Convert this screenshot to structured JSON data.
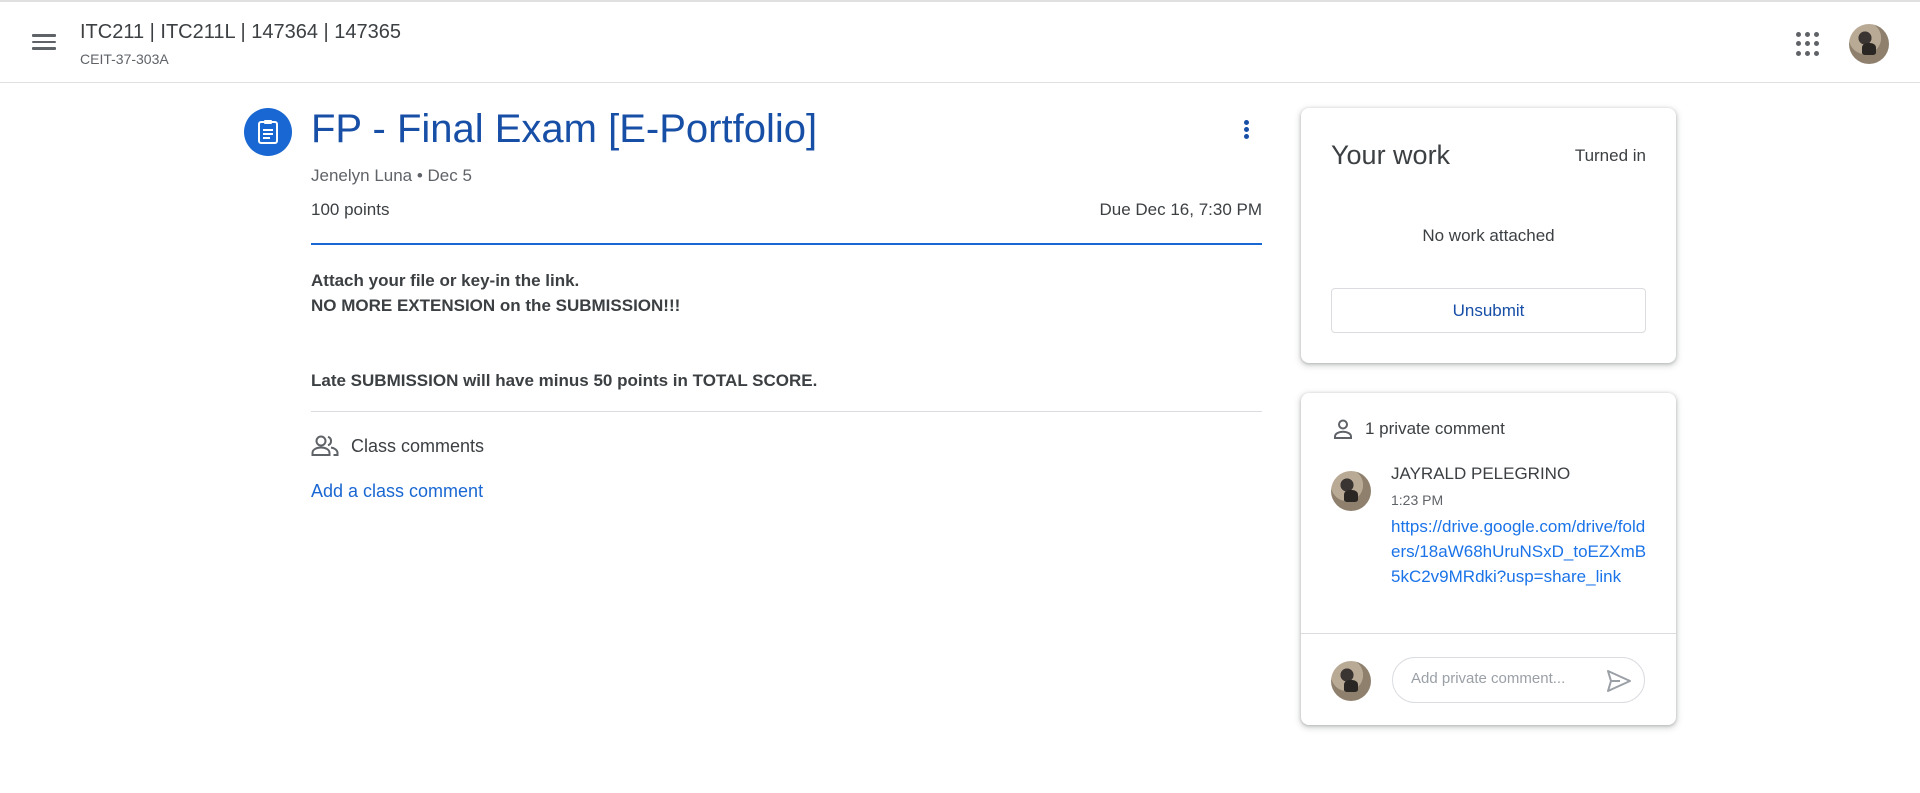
{
  "header": {
    "course_title": "ITC211 | ITC211L | 147364 | 147365",
    "course_section": "CEIT-37-303A",
    "menu_icon": "hamburger-menu-icon",
    "apps_icon": "google-apps-icon"
  },
  "assignment": {
    "icon": "assignment-icon",
    "title": "FP - Final Exam [E-Portfolio]",
    "meta": "Jenelyn Luna • Dec 5",
    "points": "100 points",
    "due": "Due Dec 16, 7:30 PM",
    "instructions": {
      "line1": "Attach your file or key-in the link.",
      "line2": "NO MORE EXTENSION on the SUBMISSION!!!",
      "line3": "Late SUBMISSION will have minus 50 points in TOTAL SCORE."
    }
  },
  "class_comments": {
    "label": "Class comments",
    "add_label": "Add a class comment"
  },
  "your_work": {
    "title": "Your work",
    "status": "Turned in",
    "empty_text": "No work attached",
    "unsubmit_label": "Unsubmit"
  },
  "private_comments": {
    "header": "1 private comment",
    "comment": {
      "author": "JAYRALD PELEGRINO",
      "time": "1:23 PM",
      "text": "https://drive.google.com/drive/folders/18aW68hUruNSxD_toEZXmB5kC2v9MRdki?usp=share_link"
    },
    "input_placeholder": "Add private comment..."
  },
  "colors": {
    "accent": "#1967d2",
    "title_blue": "#174ea6",
    "link_blue": "#1a73e8",
    "text": "#3c4043",
    "muted": "#5f6368",
    "divider": "#dadce0"
  }
}
